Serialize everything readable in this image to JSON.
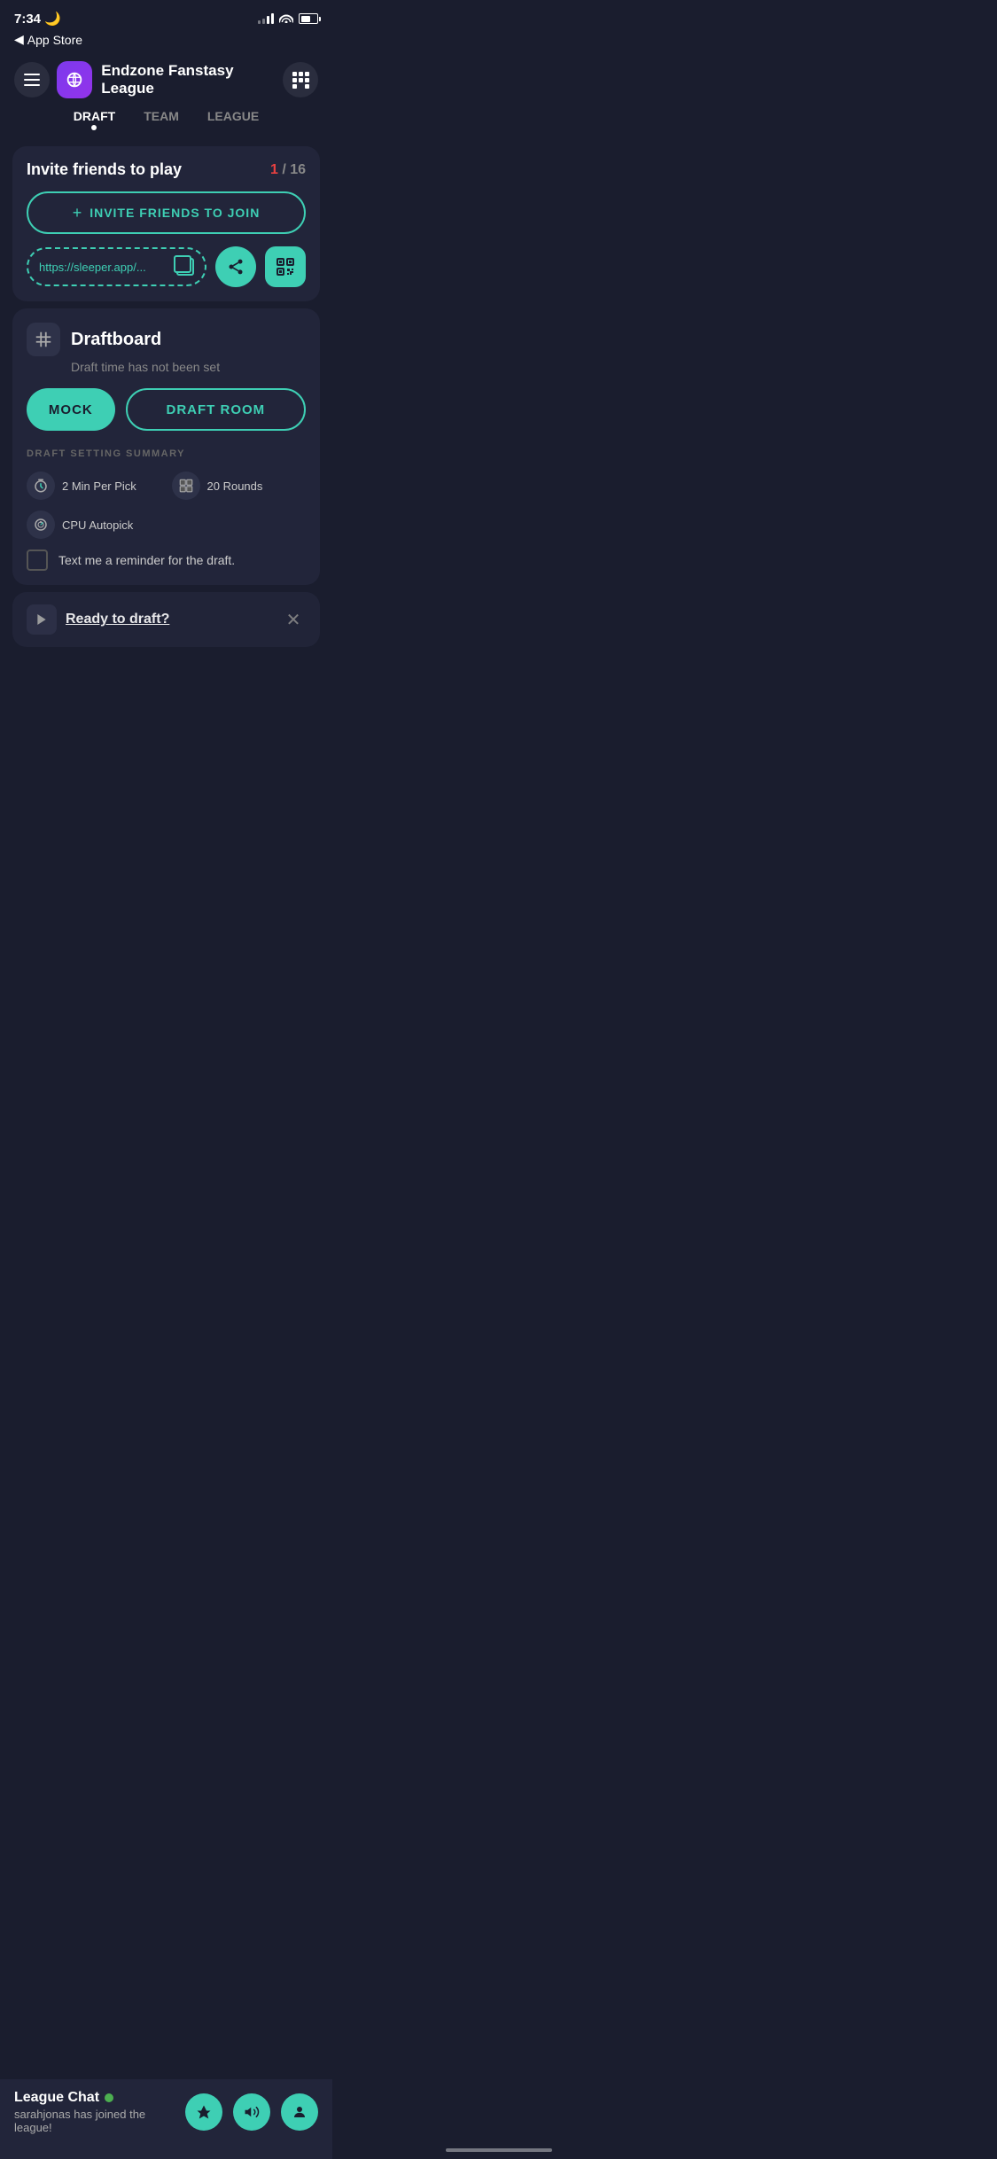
{
  "status": {
    "time": "7:34",
    "back_label": "App Store"
  },
  "header": {
    "league_name": "Endzone Fanstasy League",
    "league_icon": "🏈"
  },
  "tabs": [
    {
      "label": "DRAFT",
      "active": true
    },
    {
      "label": "TEAM",
      "active": false
    },
    {
      "label": "LEAGUE",
      "active": false
    }
  ],
  "invite_card": {
    "title": "Invite friends to play",
    "count_current": "1",
    "count_total": "16",
    "invite_button_label": "INVITE FRIENDS TO JOIN",
    "link_url": "https://sleeper.app/...",
    "copy_tooltip": "Copy link",
    "share_tooltip": "Share",
    "qr_tooltip": "QR Code"
  },
  "draftboard_card": {
    "title": "Draftboard",
    "subtitle": "Draft time has not been set",
    "mock_label": "MOCK",
    "draft_room_label": "DRAFT ROOM",
    "settings_section_title": "DRAFT SETTING SUMMARY",
    "settings": [
      {
        "icon": "⏱",
        "label": "2 Min Per Pick"
      },
      {
        "icon": "⊞",
        "label": "20 Rounds"
      },
      {
        "icon": "🤖",
        "label": "CPU Autopick"
      }
    ],
    "reminder_label": "Text me a reminder for the draft."
  },
  "bottom_banner": {
    "title": "Ready to draft?"
  },
  "league_chat": {
    "title": "League Chat",
    "subtitle": "sarahjonas has joined the league!"
  }
}
